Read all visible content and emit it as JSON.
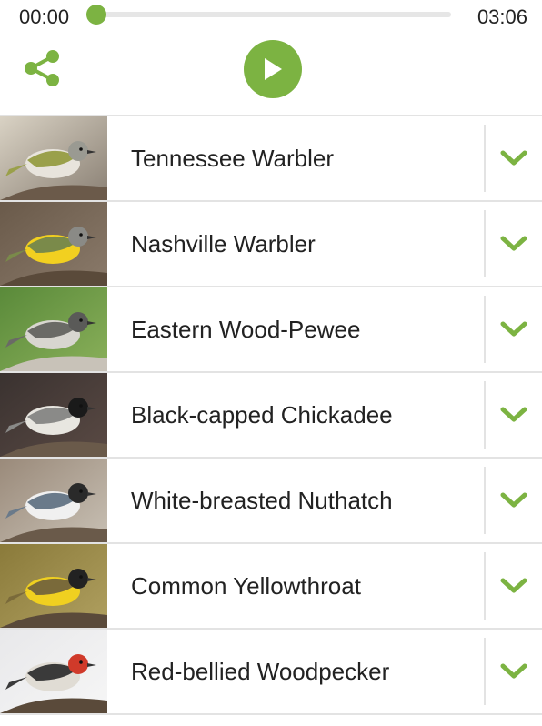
{
  "player": {
    "elapsed": "00:00",
    "duration": "03:06",
    "progress": 0.0
  },
  "colors": {
    "accent": "#7cb342",
    "track": "#e6e6e6",
    "divider": "#e3e3e3",
    "text": "#222222"
  },
  "icons": {
    "share": "share-icon",
    "play": "play-icon",
    "expand": "chevron-down-icon"
  },
  "birds": [
    {
      "name": "Tennessee Warbler",
      "image": "tennessee-warbler-photo"
    },
    {
      "name": "Nashville Warbler",
      "image": "nashville-warbler-photo"
    },
    {
      "name": "Eastern Wood-Pewee",
      "image": "eastern-wood-pewee-photo"
    },
    {
      "name": "Black-capped Chickadee",
      "image": "black-capped-chickadee-photo"
    },
    {
      "name": "White-breasted Nuthatch",
      "image": "white-breasted-nuthatch-photo"
    },
    {
      "name": "Common Yellowthroat",
      "image": "common-yellowthroat-photo"
    },
    {
      "name": "Red-bellied Woodpecker",
      "image": "red-bellied-woodpecker-photo"
    }
  ]
}
